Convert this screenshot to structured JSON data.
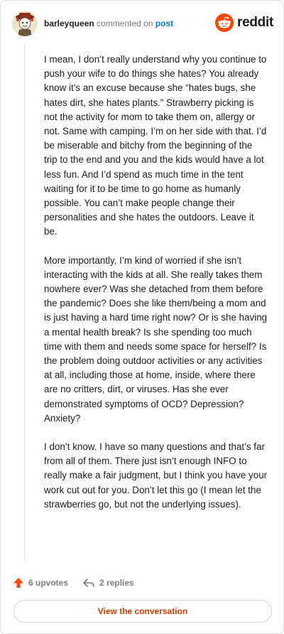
{
  "header": {
    "username": "barleyqueen",
    "action": "commented on",
    "target": "post",
    "brand": "reddit",
    "brand_color": "#ff4500",
    "avatar_icon": "user-avatar-icon"
  },
  "comment": {
    "paragraphs": [
      "I mean, I don’t really understand why you continue to push your wife to do things she hates? You already know it’s an excuse because she “hates bugs, she hates dirt, she hates plants.” Strawberry picking is not the activity for mom to take them on, allergy or not. Same with camping. I’m on her side with that. I’d be miserable and bitchy from the beginning of the trip to the end and you and the kids would have a lot less fun. And I’d spend as much time in the tent waiting for it to be time to go home as humanly possible. You can’t make people change their personalities and she hates the outdoors. Leave it be.",
      "More importantly, I’m kind of worried if she isn’t interacting with the kids at all. She really takes them nowhere ever? Was she detached from them before the pandemic? Does she like them/being a mom and is just having a hard time right now? Or is she having a mental health break? Is she spending too much time with them and needs some space for herself? Is the problem doing outdoor activities or any activities at all, including those at home, inside, where there are no critters, dirt, or viruses. Has she ever demonstrated symptoms of OCD? Depression? Anxiety?",
      "I don’t know. I have so many questions and that’s far from all of them. There just isn’t enough INFO to really make a fair judgment, but I think you have your work cut out for you. Don’t let this go (I mean let the strawberries go, but not the underlying issues)."
    ]
  },
  "actions": {
    "upvotes": "6 upvotes",
    "replies": "2 replies",
    "upvote_icon": "upvote-arrow-icon",
    "reply_icon": "reply-arrow-icon",
    "upvote_color": "#ff4500"
  },
  "cta": {
    "label": "View the conversation",
    "color": "#d93a00"
  }
}
